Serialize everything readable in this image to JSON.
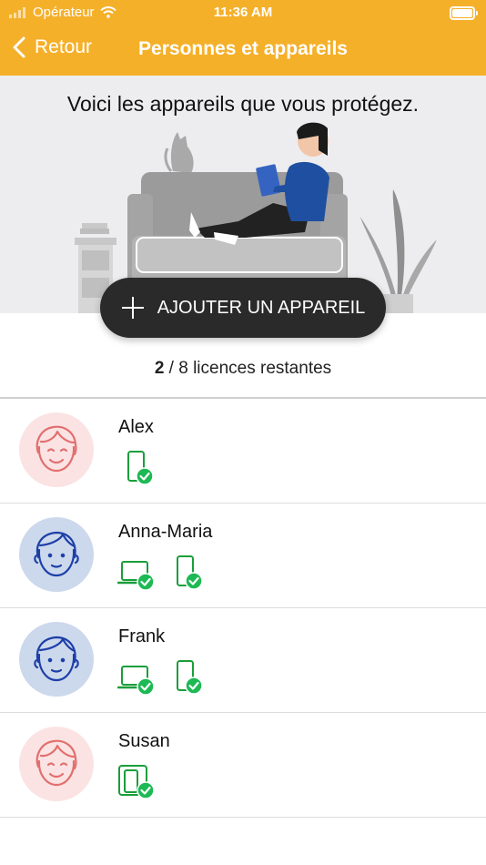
{
  "status_bar": {
    "carrier": "Opérateur",
    "time": "11:36 AM"
  },
  "nav": {
    "back_label": "Retour",
    "title": "Personnes et appareils"
  },
  "hero": {
    "text": "Voici les appareils que vous protégez."
  },
  "add_device_label": "AJOUTER UN APPAREIL",
  "licenses": {
    "remaining": "2",
    "rest": " / 8 licences restantes"
  },
  "colors": {
    "accent": "#f5b02a",
    "check": "#1db954",
    "device": "#1a9e3b",
    "pink_avatar": "#fbe3e3",
    "blue_avatar": "#ccd8ec"
  },
  "people": [
    {
      "name": "Alex",
      "avatar": "pink-face-icon",
      "devices": [
        "phone-protected-icon"
      ]
    },
    {
      "name": "Anna-Maria",
      "avatar": "blue-face-icon",
      "devices": [
        "laptop-protected-icon",
        "phone-protected-icon"
      ]
    },
    {
      "name": "Frank",
      "avatar": "blue-face-icon",
      "devices": [
        "laptop-protected-icon",
        "phone-protected-icon"
      ]
    },
    {
      "name": "Susan",
      "avatar": "pink-face-icon",
      "devices": [
        "tablet-protected-icon"
      ]
    }
  ]
}
